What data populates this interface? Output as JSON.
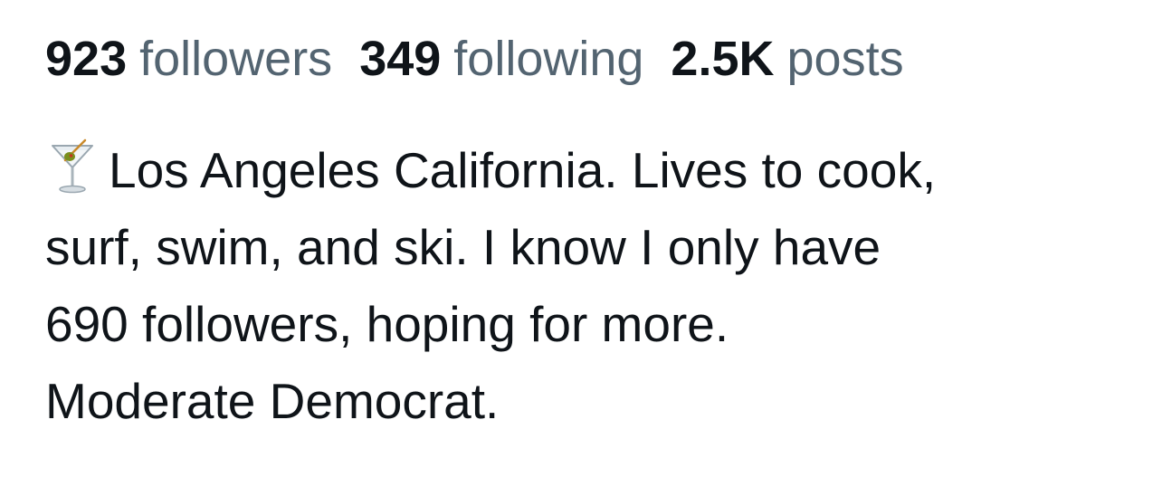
{
  "profile": {
    "stats": {
      "followers_count": "923",
      "followers_label": "followers",
      "following_count": "349",
      "following_label": "following",
      "posts_count": "2.5K",
      "posts_label": "posts"
    },
    "bio": {
      "emoji_icon": "martini-glass-icon",
      "lines": [
        "Los Angeles California. Lives to cook,",
        "surf, swim, and ski. I know I only have",
        "690 followers, hoping for more.",
        "Moderate Democrat."
      ]
    },
    "colors": {
      "primary_text": "#0f1419",
      "secondary_text": "#536471"
    }
  }
}
